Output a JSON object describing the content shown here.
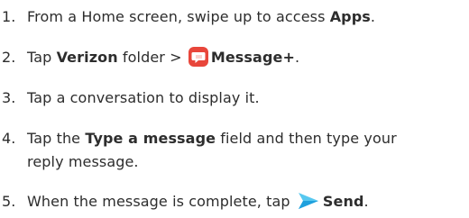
{
  "steps": [
    {
      "num": "1.",
      "pre": "From a Home screen, swipe up to access ",
      "bold": "Apps",
      "post": "."
    },
    {
      "num": "2.",
      "pre": "Tap ",
      "bold": "Verizon",
      "mid": " folder > ",
      "icon": "message-plus-app-icon",
      "bold2": "Message+",
      "post": "."
    },
    {
      "num": "3.",
      "text": "Tap a conversation to display it."
    },
    {
      "num": "4.",
      "pre": "Tap the ",
      "bold": "Type a message",
      "post": " field and then type your",
      "line2": "reply message."
    },
    {
      "num": "5.",
      "pre": "When the message is complete, tap ",
      "icon": "send-arrow-icon",
      "bold": "Send",
      "post": "."
    }
  ],
  "colors": {
    "text": "#2d2d2d",
    "message_icon": "#e8463b",
    "send_icon_light": "#57c8f0",
    "send_icon_dark": "#1fa0dd"
  }
}
